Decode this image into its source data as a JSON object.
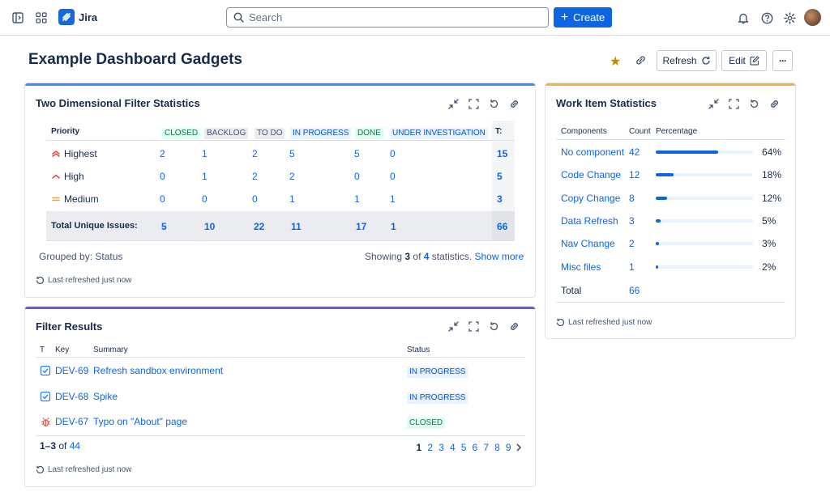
{
  "app": {
    "name": "Jira",
    "search_placeholder": "Search",
    "create_label": "Create"
  },
  "header": {
    "title": "Example Dashboard Gadgets",
    "refresh_label": "Refresh",
    "edit_label": "Edit",
    "more_label": "···"
  },
  "two_dim": {
    "title": "Two Dimensional Filter Statistics",
    "col_header": "Priority",
    "statuses": [
      "CLOSED",
      "BACKLOG",
      "TO DO",
      "IN PROGRESS",
      "DONE",
      "UNDER INVESTIGATION"
    ],
    "total_header": "T:",
    "rows": [
      {
        "priority": "Highest",
        "values": [
          "2",
          "1",
          "2",
          "5",
          "5",
          "0"
        ],
        "total": "15"
      },
      {
        "priority": "High",
        "values": [
          "0",
          "1",
          "2",
          "2",
          "0",
          "0"
        ],
        "total": "5"
      },
      {
        "priority": "Medium",
        "values": [
          "0",
          "0",
          "0",
          "1",
          "1",
          "1"
        ],
        "total": "3"
      }
    ],
    "total_row": {
      "label": "Total Unique Issues:",
      "values": [
        "5",
        "10",
        "22",
        "11",
        "17",
        "1"
      ],
      "total": "66"
    },
    "grouped_by": "Grouped by: Status",
    "showing_prefix": "Showing",
    "showing_count": "3",
    "showing_of": "of",
    "showing_total": "4",
    "showing_suffix": "statistics.",
    "show_more": "Show more",
    "last_refreshed": "Last refreshed just now"
  },
  "filter_results": {
    "title": "Filter Results",
    "headers": {
      "t": "T",
      "key": "Key",
      "summary": "Summary",
      "status": "Status"
    },
    "rows": [
      {
        "type_icon": "task-icon",
        "key": "DEV-69",
        "summary": "Refresh sandbox environment",
        "status": "IN PROGRESS"
      },
      {
        "type_icon": "task-icon",
        "key": "DEV-68",
        "summary": "Spike",
        "status": "IN PROGRESS"
      },
      {
        "type_icon": "bug-icon",
        "key": "DEV-67",
        "summary": "Typo on \"About\" page",
        "status": "CLOSED"
      }
    ],
    "range": "1–3",
    "of_label": "of",
    "total": "44",
    "pages": [
      "1",
      "2",
      "3",
      "4",
      "5",
      "6",
      "7",
      "8",
      "9"
    ],
    "current_page": "1",
    "last_refreshed": "Last refreshed just now"
  },
  "work_item_stats": {
    "title": "Work Item Statistics",
    "headers": {
      "components": "Components",
      "count": "Count",
      "percentage": "Percentage"
    },
    "rows": [
      {
        "component": "No component",
        "count": "42",
        "percent": "64%",
        "fraction": 0.64
      },
      {
        "component": "Code Change",
        "count": "12",
        "percent": "18%",
        "fraction": 0.18
      },
      {
        "component": "Copy Change",
        "count": "8",
        "percent": "12%",
        "fraction": 0.12
      },
      {
        "component": "Data Refresh",
        "count": "3",
        "percent": "5%",
        "fraction": 0.05
      },
      {
        "component": "Nav Change",
        "count": "2",
        "percent": "3%",
        "fraction": 0.03
      },
      {
        "component": "Misc files",
        "count": "1",
        "percent": "2%",
        "fraction": 0.02
      }
    ],
    "total_label": "Total",
    "total": "66",
    "last_refreshed": "Last refreshed just now"
  },
  "colors": {
    "primary": "#0c66e4",
    "card1_bar": "#388bff",
    "card2_bar": "#6e5dc6",
    "card3_bar": "#f5b72f",
    "star": "#c38b00"
  }
}
